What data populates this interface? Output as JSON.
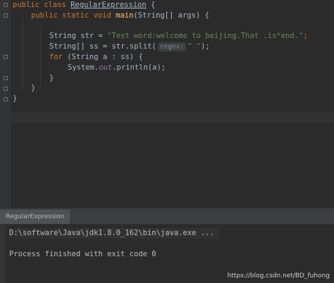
{
  "editor": {
    "lines": {
      "l1": {
        "kw_public": "public",
        "kw_class": "class",
        "class_name": "RegularExpression",
        "brace": "{"
      },
      "l2": {
        "mods": "public static void",
        "method": "main",
        "params": "(String[] args) {"
      },
      "l3": {
        "decl": "String str = ",
        "literal": "\"Test word:welcome to beijing.That .is*end.\"",
        "end": ";"
      },
      "l4": {
        "decl": "String[] ss = str.split(",
        "hint": "regex:",
        "literal": "\".\"",
        "end": ");"
      },
      "l5": {
        "kw_for": "for",
        "rest": "(String a : ss) {"
      },
      "l6": {
        "start": "System.",
        "field": "out",
        "rest": ".println(a);"
      },
      "l7": {
        "close": "}"
      },
      "l8": {
        "close": "}"
      },
      "l9": {
        "close": "}"
      }
    }
  },
  "run": {
    "tab_label": "RegularExpression",
    "console": {
      "cmd": "D:\\software\\Java\\jdk1.8.0_162\\bin\\java.exe ...",
      "exit": "Process finished with exit code 0"
    }
  },
  "watermark": "https://blog.csdn.net/BD_fuhong"
}
